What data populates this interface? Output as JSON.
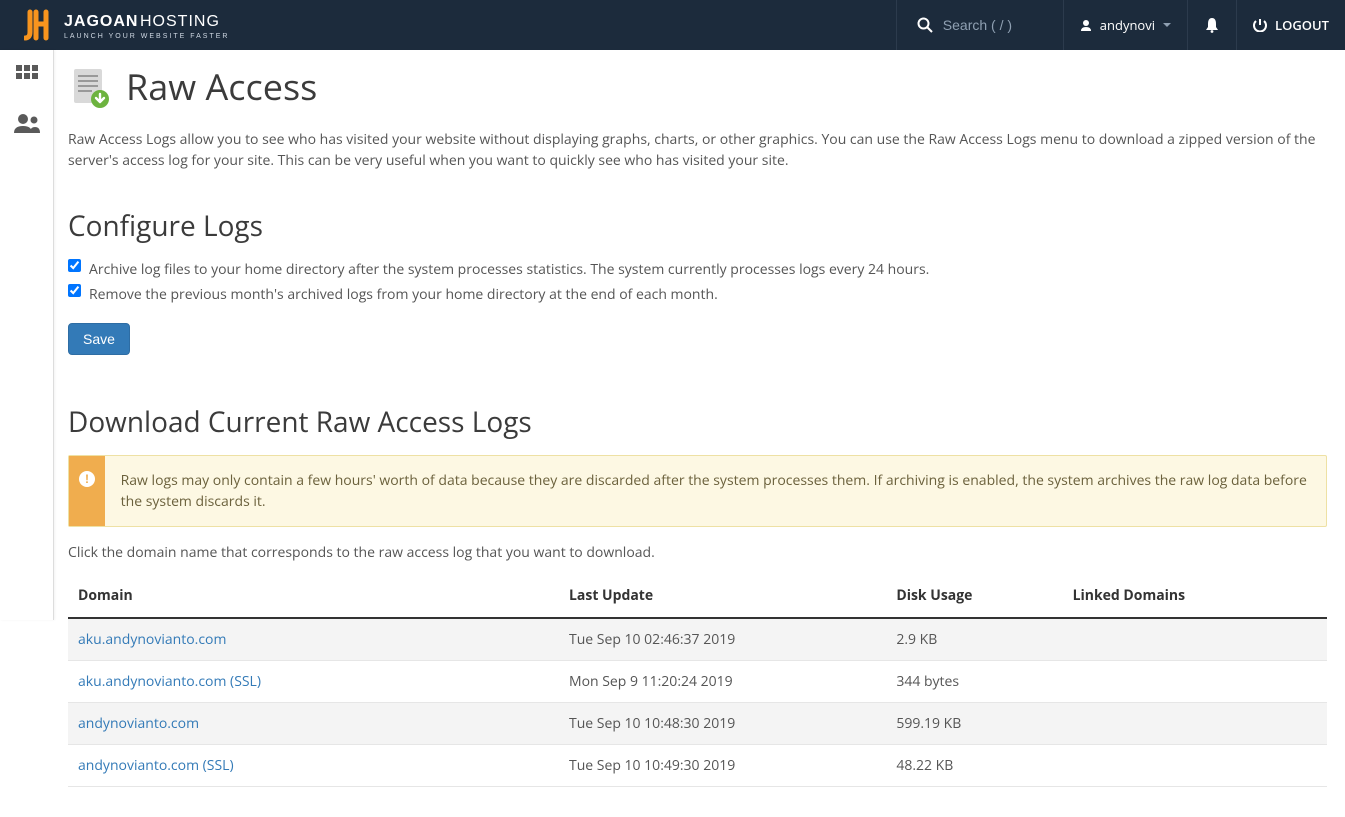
{
  "brand": {
    "name": "JAGOANHOSTING",
    "tagline": "LAUNCH YOUR WEBSITE FASTER"
  },
  "header": {
    "search_placeholder": "Search ( / )",
    "username": "andynovi",
    "logout": "LOGOUT"
  },
  "page": {
    "title": "Raw Access",
    "intro": "Raw Access Logs allow you to see who has visited your website without displaying graphs, charts, or other graphics. You can use the Raw Access Logs menu to download a zipped version of the server's access log for your site. This can be very useful when you want to quickly see who has visited your site."
  },
  "configure": {
    "heading": "Configure Logs",
    "opt_archive": "Archive log files to your home directory after the system processes statistics. The system currently processes logs every 24 hours.",
    "opt_remove": "Remove the previous month's archived logs from your home directory at the end of each month.",
    "save_label": "Save"
  },
  "download": {
    "heading": "Download Current Raw Access Logs",
    "alert": "Raw logs may only contain a few hours' worth of data because they are discarded after the system processes them. If archiving is enabled, the system archives the raw log data before the system discards it.",
    "hint": "Click the domain name that corresponds to the raw access log that you want to download.",
    "cols": {
      "domain": "Domain",
      "last_update": "Last Update",
      "disk_usage": "Disk Usage",
      "linked": "Linked Domains"
    },
    "rows": [
      {
        "domain": "aku.andynovianto.com",
        "last_update": "Tue Sep 10 02:46:37 2019",
        "disk_usage": "2.9 KB",
        "linked": ""
      },
      {
        "domain": "aku.andynovianto.com (SSL)",
        "last_update": "Mon Sep 9 11:20:24 2019",
        "disk_usage": "344 bytes",
        "linked": ""
      },
      {
        "domain": "andynovianto.com",
        "last_update": "Tue Sep 10 10:48:30 2019",
        "disk_usage": "599.19 KB",
        "linked": ""
      },
      {
        "domain": "andynovianto.com (SSL)",
        "last_update": "Tue Sep 10 10:49:30 2019",
        "disk_usage": "48.22 KB",
        "linked": ""
      }
    ]
  }
}
